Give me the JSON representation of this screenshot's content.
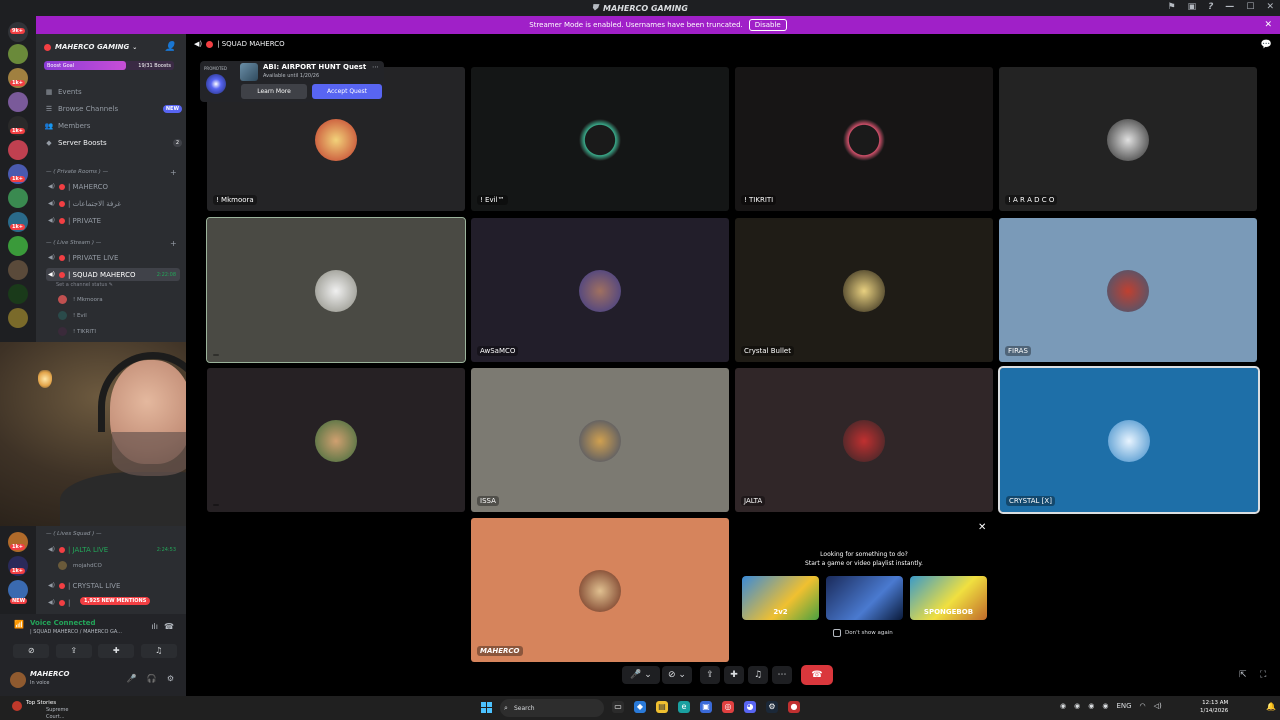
{
  "window": {
    "title": "MAHERCO GAMING"
  },
  "banner": {
    "text": "Streamer Mode is enabled. Usernames have been truncated.",
    "button": "Disable"
  },
  "rail": {
    "badges": [
      "9k+",
      "1k+",
      "1k+",
      "1k+",
      "1k+",
      "1k+",
      "1k+",
      "NEW"
    ]
  },
  "sidebar": {
    "server_name": "MAHERCO GAMING",
    "boost_goal_label": "Boost Goal",
    "boost_progress": 0.63,
    "boost_count": "19/31 Boosts",
    "menu": [
      {
        "label": "Events",
        "icon": "calendar-icon"
      },
      {
        "label": "Browse Channels",
        "icon": "browse-icon",
        "badge": "NEW"
      },
      {
        "label": "Members",
        "icon": "members-icon"
      },
      {
        "label": "Server Boosts",
        "icon": "boost-icon",
        "count": "2"
      }
    ],
    "cat_private": "— ( Private Rooms ) —",
    "private_channels": [
      "| MAHERCO",
      "| غرفة الاجتماعات",
      "| PRIVATE"
    ],
    "cat_live": "— ( Live Stream ) —",
    "live_channels": [
      {
        "name": "| PRIVATE LIVE",
        "timer": ""
      },
      {
        "name": "| SQUAD MAHERCO",
        "timer": "2:22:08"
      }
    ],
    "channel_status": "Set a channel status",
    "squad_members": [
      "! Mkmoora",
      "! Evil",
      "! TIKRITI"
    ],
    "cat_lives_squad": "— ( Lives Squad ) —",
    "lives_channels": [
      {
        "name": "| JALTA LIVE",
        "timer": "2:24:53"
      },
      {
        "name": "| CRYSTAL LIVE",
        "timer": ""
      },
      {
        "name": "| ",
        "timer": ""
      }
    ],
    "jalta_member": "mojahdCO",
    "mentions": "1,925 NEW MENTIONS"
  },
  "voice": {
    "status": "Voice Connected",
    "channel": "| SQUAD MAHERCO / MAHERCO GA..."
  },
  "user": {
    "name": "MAHERCO",
    "status": "In voice"
  },
  "call": {
    "channel_name": "| SQUAD MAHERCO",
    "tiles": [
      {
        "name": "! Mkmoora"
      },
      {
        "name": "! Evil™"
      },
      {
        "name": "! TIKRITI"
      },
      {
        "name": "! A R A D C O"
      },
      {
        "name": ""
      },
      {
        "name": "AwSaMCO"
      },
      {
        "name": "Crystal Bullet"
      },
      {
        "name": "FIRAS"
      },
      {
        "name": ""
      },
      {
        "name": "ISSA"
      },
      {
        "name": "JALTA"
      },
      {
        "name": "CRYSTAL [X]"
      },
      {
        "name": "MAHERCO"
      }
    ]
  },
  "promo": {
    "tag": "PROMOTED",
    "title": "ABI: AIRPORT HUNT Quest",
    "subtitle": "Available until 1/20/26",
    "learn_more": "Learn More",
    "accept": "Accept Quest"
  },
  "activity": {
    "title": "Looking for something to do?",
    "subtitle": "Start a game or video playlist instantly.",
    "games": [
      "2v2",
      "",
      "SPONGEBOB"
    ],
    "dont_show": "Don't show again"
  },
  "taskbar": {
    "news_title": "Top Stories",
    "news_sub": "Supreme Court...",
    "search": "Search",
    "lang": "ENG",
    "time": "12:13 AM",
    "date": "1/14/2026"
  }
}
